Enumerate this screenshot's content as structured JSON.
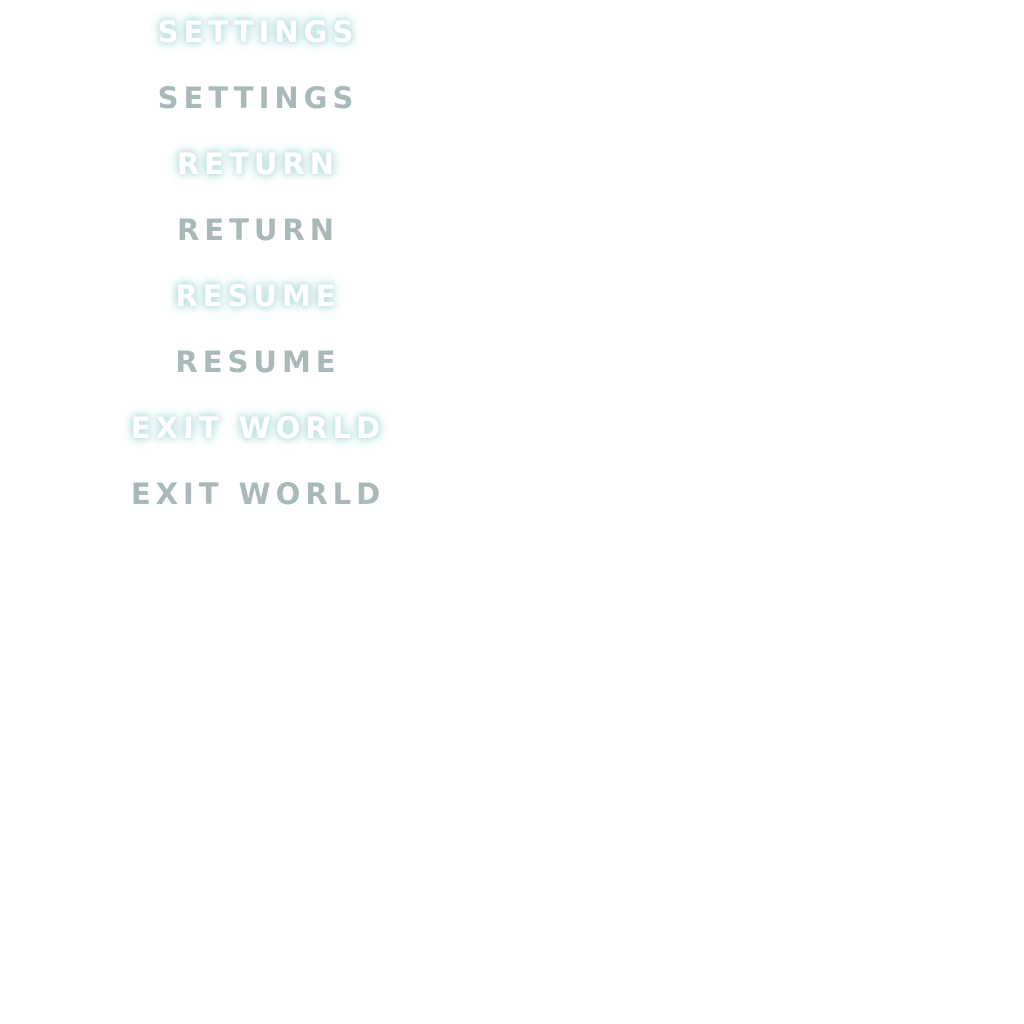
{
  "menu": {
    "settings": {
      "hover_label": "SETTINGS",
      "normal_label": "SETTINGS"
    },
    "return": {
      "hover_label": "RETURN",
      "normal_label": "RETURN"
    },
    "resume": {
      "hover_label": "RESUME",
      "normal_label": "RESUME"
    },
    "exit_world": {
      "hover_label": "EXIT WORLD",
      "normal_label": "EXIT WORLD"
    }
  },
  "colors": {
    "background": "#ffffff",
    "normal_text": "#a9b9ba",
    "hover_text": "#ffffff",
    "hover_glow": "#bfe4e0"
  }
}
